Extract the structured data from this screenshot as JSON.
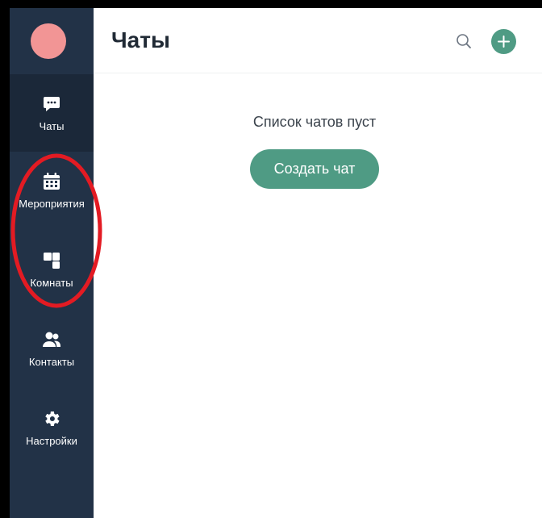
{
  "header": {
    "title": "Чаты",
    "search_icon": "search-icon",
    "add_icon": "plus-icon"
  },
  "sidebar": {
    "avatar_color": "#f29595",
    "items": [
      {
        "label": "Чаты",
        "icon": "chat-bubble-icon",
        "active": true
      },
      {
        "label": "Мероприятия",
        "icon": "calendar-icon",
        "active": false
      },
      {
        "label": "Комнаты",
        "icon": "rooms-icon",
        "active": false
      },
      {
        "label": "Контакты",
        "icon": "contacts-icon",
        "active": false
      },
      {
        "label": "Настройки",
        "icon": "gear-icon",
        "active": false
      }
    ]
  },
  "main": {
    "empty_message": "Список чатов пуст",
    "create_button": "Создать чат"
  },
  "colors": {
    "sidebar_bg": "#223247",
    "sidebar_active_bg": "#1b2839",
    "accent": "#4f9b84",
    "annotation": "#e31b23"
  }
}
